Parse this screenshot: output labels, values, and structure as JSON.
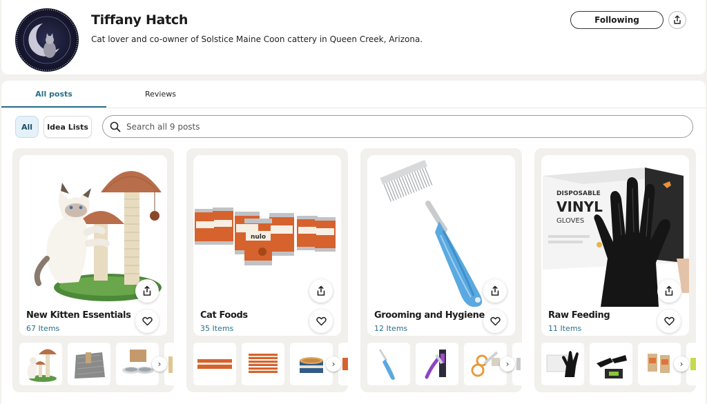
{
  "profile": {
    "name": "Tiffany Hatch",
    "bio": "Cat lover and co-owner of Solstice Maine Coon cattery in Queen Creek, Arizona.",
    "following_label": "Following"
  },
  "tabs": [
    {
      "label": "All posts",
      "active": true
    },
    {
      "label": "Reviews",
      "active": false
    }
  ],
  "filters": {
    "all_label": "All",
    "idea_lists_label": "Idea Lists"
  },
  "search": {
    "placeholder": "Search all 9 posts"
  },
  "colors": {
    "accent": "#2a6f86",
    "card_background": "#f1f0ec"
  },
  "cards": [
    {
      "title": "New Kitten Essentials",
      "count": "67 Items",
      "image": "cat-tree-photo",
      "thumbnails": [
        "cat-tree-thumb",
        "litter-mat-thumb",
        "food-bowl-thumb"
      ]
    },
    {
      "title": "Cat Foods",
      "count": "35 Items",
      "image": "nulo-cans-photo",
      "thumbnails": [
        "cans-row-thumb",
        "cans-stack-thumb",
        "open-can-thumb"
      ]
    },
    {
      "title": "Grooming and Hygiene",
      "count": "12 Items",
      "image": "grooming-comb-photo",
      "thumbnails": [
        "comb-thumb",
        "brush-thumb",
        "nail-clipper-thumb"
      ]
    },
    {
      "title": "Raw Feeding",
      "count": "11 Items",
      "image": "vinyl-gloves-photo",
      "thumbnails": [
        "gloves-box-thumb",
        "gloves-pair-thumb",
        "food-bags-thumb"
      ]
    }
  ],
  "glove_box_text": {
    "line1": "DISPOSABLE",
    "line2": "VINYL",
    "line3": "GLOVES"
  },
  "can_brand": "nulo"
}
